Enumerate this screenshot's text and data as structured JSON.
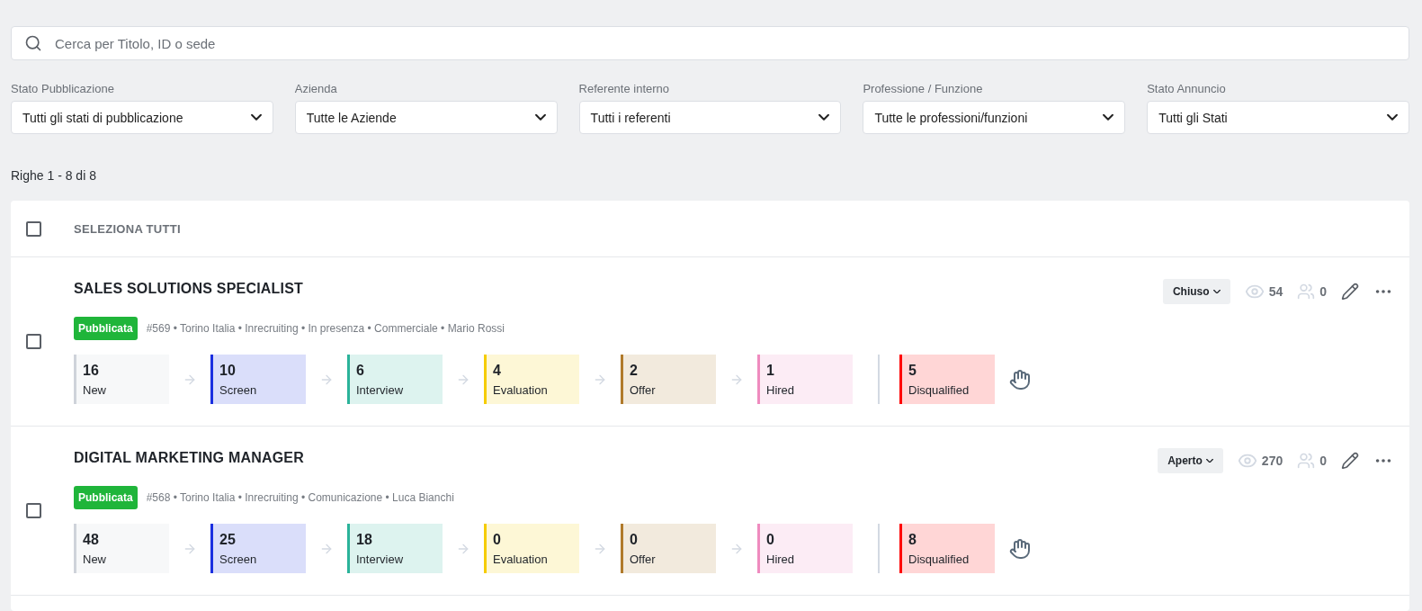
{
  "search": {
    "placeholder": "Cerca per Titolo, ID o sede"
  },
  "filters": [
    {
      "label": "Stato Pubblicazione",
      "value": "Tutti gli stati di pubblicazione"
    },
    {
      "label": "Azienda",
      "value": "Tutte le Aziende"
    },
    {
      "label": "Referente interno",
      "value": "Tutti i referenti"
    },
    {
      "label": "Professione / Funzione",
      "value": "Tutte le professioni/funzioni"
    },
    {
      "label": "Stato Annuncio",
      "value": "Tutti gli Stati"
    }
  ],
  "row_count": "Righe 1 - 8 di 8",
  "list": {
    "select_all": {
      "label": "SELEZIONA TUTTI",
      "checked": false
    },
    "jobs": [
      {
        "title": "SALES SOLUTIONS SPECIALIST",
        "checked": false,
        "status": "Pubblicata",
        "meta": "#569 • Torino Italia • Inrecruiting • In presenza • Commerciale • Mario Rossi",
        "state": "Chiuso",
        "views": "54",
        "candidates": "0",
        "stages": [
          {
            "kind": "stage",
            "count": "16",
            "label": "New",
            "color": "#cfd3da"
          },
          {
            "kind": "stage",
            "count": "10",
            "label": "Screen",
            "color": "#1a2fe0"
          },
          {
            "kind": "stage",
            "count": "6",
            "label": "Interview",
            "color": "#2bb39a"
          },
          {
            "kind": "stage",
            "count": "4",
            "label": "Evaluation",
            "color": "#f5cc00"
          },
          {
            "kind": "stage",
            "count": "2",
            "label": "Offer",
            "color": "#b07a2a"
          },
          {
            "kind": "stage",
            "count": "1",
            "label": "Hired",
            "color": "#ef8bbf"
          },
          {
            "kind": "rejected",
            "count": "5",
            "label": "Disqualified",
            "color": "#ff0000"
          }
        ]
      },
      {
        "title": "DIGITAL MARKETING MANAGER",
        "checked": false,
        "status": "Pubblicata",
        "meta": "#568 • Torino Italia • Inrecruiting • Comunicazione • Luca Bianchi",
        "state": "Aperto",
        "views": "270",
        "candidates": "0",
        "stages": [
          {
            "kind": "stage",
            "count": "48",
            "label": "New",
            "color": "#cfd3da"
          },
          {
            "kind": "stage",
            "count": "25",
            "label": "Screen",
            "color": "#1a2fe0"
          },
          {
            "kind": "stage",
            "count": "18",
            "label": "Interview",
            "color": "#2bb39a"
          },
          {
            "kind": "stage",
            "count": "0",
            "label": "Evaluation",
            "color": "#f5cc00"
          },
          {
            "kind": "stage",
            "count": "0",
            "label": "Offer",
            "color": "#b07a2a"
          },
          {
            "kind": "stage",
            "count": "0",
            "label": "Hired",
            "color": "#ef8bbf"
          },
          {
            "kind": "rejected",
            "count": "8",
            "label": "Disqualified",
            "color": "#ff0000"
          }
        ]
      }
    ]
  }
}
